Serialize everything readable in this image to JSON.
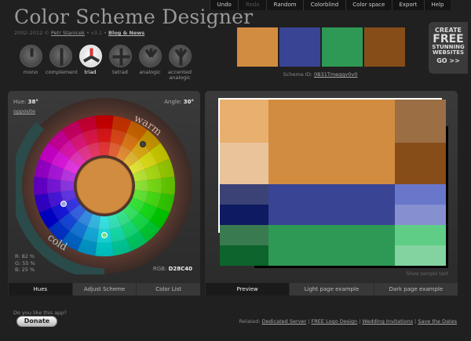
{
  "app": {
    "title": "Color Scheme Designer",
    "copyright": "2002–2012 ©",
    "author": "Petr Stanicek",
    "version": "• v3.1",
    "news_link": "Blog & News"
  },
  "menu": [
    {
      "label": "Undo",
      "enabled": true
    },
    {
      "label": "Redo",
      "enabled": false
    },
    {
      "label": "Random",
      "enabled": true
    },
    {
      "label": "Colorblind",
      "enabled": true
    },
    {
      "label": "Color space",
      "enabled": true
    },
    {
      "label": "Export",
      "enabled": true
    },
    {
      "label": "Help",
      "enabled": true
    }
  ],
  "schemes": [
    {
      "id": "mono",
      "label": "mono",
      "active": false,
      "icon": "mono-scheme-icon"
    },
    {
      "id": "complement",
      "label": "complement",
      "active": false,
      "icon": "complement-scheme-icon"
    },
    {
      "id": "triad",
      "label": "triad",
      "active": true,
      "icon": "triad-scheme-icon"
    },
    {
      "id": "tetrad",
      "label": "tetrad",
      "active": false,
      "icon": "tetrad-scheme-icon"
    },
    {
      "id": "analogic",
      "label": "analogic",
      "active": false,
      "icon": "analogic-scheme-icon"
    },
    {
      "id": "accented",
      "label": "accented analogic",
      "active": false,
      "icon": "accented-analogic-scheme-icon"
    }
  ],
  "swatches": [
    "#D28C40",
    "#3A4495",
    "#2E9954",
    "#874D18"
  ],
  "scheme_id": {
    "label": "Scheme ID:",
    "value": "0B31Tmeqqv0v0"
  },
  "ad": {
    "line1": "CREATE",
    "line2": "FREE",
    "line3": "STUNNING",
    "line4": "WEBSITES",
    "cta": "GO >>"
  },
  "wheel": {
    "hue_label": "Hue:",
    "hue_value": "38°",
    "opposite": "opposite",
    "angle_label": "Angle:",
    "angle_value": "30°",
    "warm_label": "warm",
    "cold_label": "cold",
    "rgb_lines": [
      "R: 82 %",
      "G: 55 %",
      "B: 25 %"
    ],
    "rgb_hex_label": "RGB:",
    "rgb_hex_value": "D28C40",
    "center_color": "#D28C40"
  },
  "left_tabs": [
    {
      "label": "Hues",
      "active": true
    },
    {
      "label": "Adjust Scheme",
      "active": false
    },
    {
      "label": "Color List",
      "active": false
    }
  ],
  "right_tabs": [
    {
      "label": "Preview",
      "active": true
    },
    {
      "label": "Light page example",
      "active": false
    },
    {
      "label": "Dark page example",
      "active": false
    }
  ],
  "preview": {
    "show_sample": "Show sample text",
    "primary": [
      "#D28C40",
      "#E8AF6F",
      "#E9C39A",
      "#9C6E44",
      "#874D18"
    ],
    "secondary_a": [
      "#3A4495",
      "#3B4276",
      "#0E1A62",
      "#6977CA",
      "#8690D0"
    ],
    "secondary_b": [
      "#2E9954",
      "#397A50",
      "#0D642C",
      "#5FCD86",
      "#82D3A0"
    ]
  },
  "donate": {
    "question": "Do you like this app?",
    "button": "Donate"
  },
  "footer": {
    "related": "Related:",
    "links": [
      "Dedicated Server",
      "FREE Logo Design",
      "Wedding Invitations",
      "Save the Dates"
    ]
  }
}
